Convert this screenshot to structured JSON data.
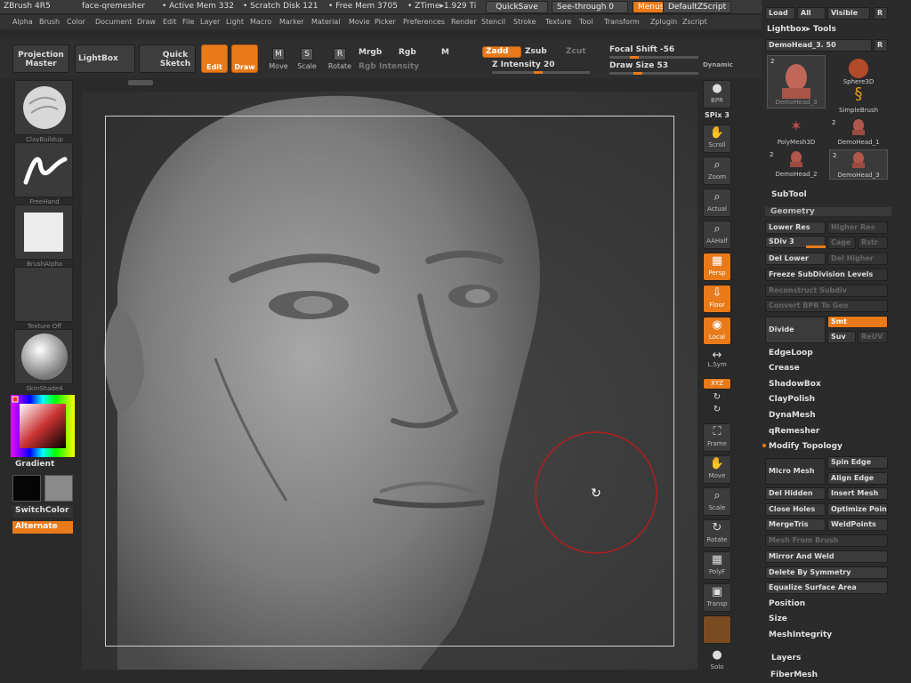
{
  "titlebar": {
    "app": "ZBrush 4R5",
    "file": "face-qremesher",
    "active_mem": "• Active Mem 332",
    "scratch": "• Scratch Disk 121",
    "free_mem": "• Free Mem 3705",
    "ztime": "• ZTime▸1.929  Ti",
    "quicksave": "QuickSave",
    "seethrough": "See-through  0",
    "menus": "Menus",
    "zscript": "DefaultZScript"
  },
  "menu": [
    "Alpha",
    "Brush",
    "Color",
    "Document",
    "Draw",
    "Edit",
    "File",
    "Layer",
    "Light",
    "Macro",
    "Marker",
    "Material",
    "Movie",
    "Picker",
    "Preferences",
    "Render",
    "Stencil",
    "Stroke",
    "Texture",
    "Tool",
    "Transform",
    "Zplugin",
    "Zscript"
  ],
  "shelf": {
    "projection_master": "Projection Master",
    "lightbox": "LightBox",
    "quick_sketch": "Quick Sketch",
    "edit": "Edit",
    "draw": "Draw",
    "move": "Move",
    "scale": "Scale",
    "rotate": "Rotate",
    "mrgb": "Mrgb",
    "rgb": "Rgb",
    "m": "M",
    "rgb_intensity": "Rgb Intensity",
    "zadd": "Zadd",
    "zsub": "Zsub",
    "zcut": "Zcut",
    "z_intensity": "Z Intensity 20",
    "focal_shift": "Focal Shift -56",
    "draw_size": "Draw Size 53",
    "dynamic": "Dynamic"
  },
  "lefttray": {
    "brush": "ClayBuildup",
    "stroke": "FreeHand",
    "alpha": "BrushAlpha",
    "texture": "Texture Off",
    "material": "SkinShade4",
    "gradient": "Gradient",
    "switchcolor": "SwitchColor",
    "alternate": "Alternate"
  },
  "righttools": {
    "bpr": "BPR",
    "spix": "SPix 3",
    "scroll": "Scroll",
    "zoom": "Zoom",
    "actual": "Actual",
    "aahalf": "AAHalf",
    "persp": "Persp",
    "floor": "Floor",
    "local": "Local",
    "lsym": "L.Sym",
    "xyz": "XYZ",
    "frame": "Frame",
    "move": "Move",
    "scale": "Scale",
    "rotate": "Rotate",
    "polyf": "PolyF",
    "transp": "Transp",
    "solo": "Solo"
  },
  "rightpanel": {
    "top_btns": [
      "Load",
      "All",
      "Visible",
      "R"
    ],
    "lightbox_tools": "Lightbox▸ Tools",
    "demohead_slider": "DemoHead_3. 50",
    "r": "R",
    "tools": [
      {
        "count": "2",
        "name": "DemoHead_3"
      },
      {
        "count": "",
        "name": "Sphere3D"
      },
      {
        "count": "",
        "name": "SimpleBrush"
      },
      {
        "count": "",
        "name": "PolyMesh3D"
      },
      {
        "count": "2",
        "name": "DemoHead_1"
      },
      {
        "count": "2",
        "name": "DemoHead_2"
      },
      {
        "count": "2",
        "name": "DemoHead_3"
      }
    ],
    "subtool": "SubTool",
    "geometry": "Geometry",
    "lower_res": "Lower Res",
    "higher_res": "Higher Res",
    "sdiv": "SDiv 3",
    "cage": "Cage",
    "rstr": "Rstr",
    "del_lower": "Del Lower",
    "del_higher": "Del Higher",
    "freeze": "Freeze SubDivision Levels",
    "reconstruct": "Reconstruct Subdiv",
    "convert_bpr": "Convert BPR To Geo",
    "divide": "Divide",
    "smt": "Smt",
    "suv": "Suv",
    "reuv": "ReUV",
    "edgeloop": "EdgeLoop",
    "crease": "Crease",
    "shadowbox": "ShadowBox",
    "claypolish": "ClayPolish",
    "dynamesh": "DynaMesh",
    "qremesher": "qRemesher",
    "modify_topology": "Modify Topology",
    "micro_mesh": "Micro Mesh",
    "spin_edge": "Spin Edge",
    "align_edge": "Align Edge",
    "del_hidden": "Del Hidden",
    "insert_mesh": "Insert Mesh",
    "close_holes": "Close Holes",
    "optimize_points": "Optimize Poin",
    "mergetris": "MergeTris",
    "weldpoints": "WeldPoints",
    "mesh_from_brush": "Mesh From Brush",
    "mirror_weld": "Mirror And Weld",
    "delete_symmetry": "Delete By Symmetry",
    "equalize": "Equalize Surface Area",
    "position": "Position",
    "size": "Size",
    "meshintegrity": "MeshIntegrity",
    "layers": "Layers",
    "fibermesh": "FiberMesh"
  }
}
